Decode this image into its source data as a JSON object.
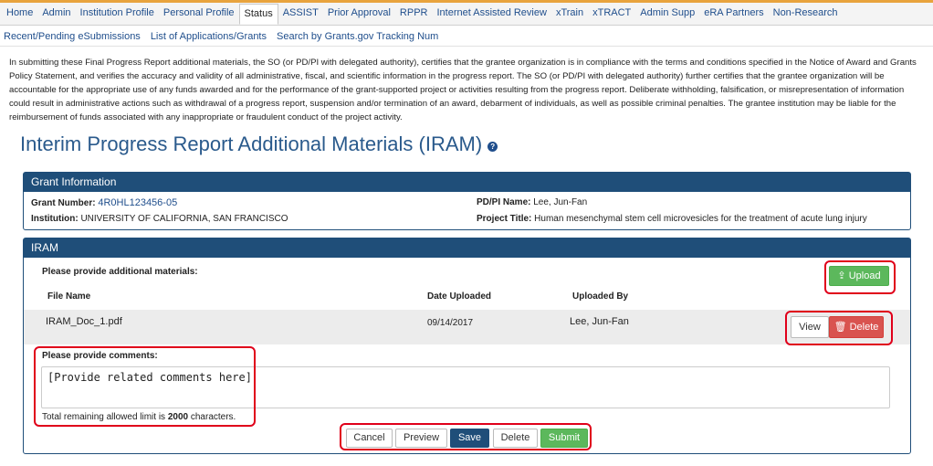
{
  "topnav": {
    "tabs": [
      {
        "label": "Home",
        "active": false
      },
      {
        "label": "Admin",
        "active": false
      },
      {
        "label": "Institution Profile",
        "active": false
      },
      {
        "label": "Personal Profile",
        "active": false
      },
      {
        "label": "Status",
        "active": true
      },
      {
        "label": "ASSIST",
        "active": false
      },
      {
        "label": "Prior Approval",
        "active": false
      },
      {
        "label": "RPPR",
        "active": false
      },
      {
        "label": "Internet Assisted Review",
        "active": false
      },
      {
        "label": "xTrain",
        "active": false
      },
      {
        "label": "xTRACT",
        "active": false
      },
      {
        "label": "Admin Supp",
        "active": false
      },
      {
        "label": "eRA Partners",
        "active": false
      },
      {
        "label": "Non-Research",
        "active": false
      }
    ]
  },
  "subnav": {
    "links": [
      "Recent/Pending eSubmissions",
      "List of Applications/Grants",
      "Search by Grants.gov Tracking Num"
    ]
  },
  "certification_text": "In submitting these Final Progress Report additional materials, the SO (or PD/PI with delegated authority), certifies that the grantee organization is in compliance with the terms and conditions specified in the Notice of Award and Grants Policy Statement, and verifies the accuracy and validity of all administrative, fiscal, and scientific information in the progress report. The SO (or PD/PI with delegated authority) further certifies that the grantee organization will be accountable for the appropriate use of any funds awarded and for the performance of the grant-supported project or activities resulting from the progress report. Deliberate withholding, falsification, or misrepresentation of information could result in administrative actions such as withdrawal of a progress report, suspension and/or termination of an award, debarment of individuals, as well as possible criminal penalties. The grantee institution may be liable for the reimbursement of funds associated with any inappropriate or fraudulent conduct of the project activity.",
  "page_title": "Interim Progress Report Additional Materials (IRAM)",
  "help_icon_glyph": "?",
  "grant_info": {
    "header": "Grant Information",
    "grant_number_label": "Grant Number:",
    "grant_number": "4R0HL123456-05",
    "institution_label": "Institution:",
    "institution": "UNIVERSITY OF CALIFORNIA, SAN FRANCISCO",
    "pdpi_label": "PD/PI Name:",
    "pdpi": "Lee, Jun-Fan",
    "project_title_label": "Project Title:",
    "project_title": "Human mesenchymal stem cell microvesicles for the treatment of acute lung injury"
  },
  "iram": {
    "header": "IRAM",
    "materials_label": "Please provide additional materials:",
    "upload_button": "Upload",
    "upload_icon_glyph": "⇪",
    "columns": {
      "file_name": "File Name",
      "date_uploaded": "Date Uploaded",
      "uploaded_by": "Uploaded By"
    },
    "files": [
      {
        "file_name": "IRAM_Doc_1.pdf",
        "date_uploaded": "09/14/2017",
        "uploaded_by": "Lee, Jun-Fan"
      }
    ],
    "view_button": "View",
    "delete_file_button": "Delete",
    "trash_icon_glyph": "🗑",
    "comments_label": "Please provide comments:",
    "comments_value": "[Provide related comments here]",
    "limit_prefix": "Total remaining allowed limit is ",
    "limit_value": "2000",
    "limit_suffix": " characters."
  },
  "actions": {
    "cancel": "Cancel",
    "preview": "Preview",
    "save": "Save",
    "delete": "Delete",
    "submit": "Submit"
  },
  "colors": {
    "nav_accent": "#e8a33d",
    "panel_header": "#1f4e79",
    "title": "#2a5a8c",
    "link": "#1f4e8c",
    "success": "#5cb85c",
    "danger": "#d9534f",
    "highlight": "#e0001a"
  }
}
